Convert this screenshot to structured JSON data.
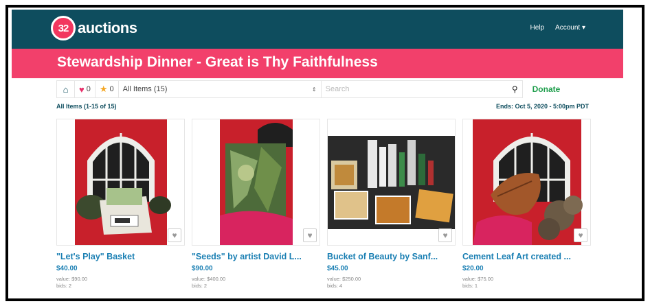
{
  "brand": {
    "logo_mark": "32",
    "logo_text": "auctions"
  },
  "topnav": {
    "help": "Help",
    "account": "Account",
    "account_caret": "▾"
  },
  "banner": {
    "title": "Stewardship Dinner - Great is Thy Faithfulness"
  },
  "toolbar": {
    "home_icon": "⌂",
    "favorites_icon": "♥",
    "favorites_count": "0",
    "starred_icon": "★",
    "starred_count": "0",
    "filter_value": "All Items (15)",
    "filter_caret": "⇕",
    "search_placeholder": "Search",
    "search_icon": "⚲",
    "donate_label": "Donate"
  },
  "list": {
    "range_label": "All Items (1-15 of 15)",
    "ends_label": "Ends: Oct 5, 2020 - 5:00pm PDT"
  },
  "items": [
    {
      "title": "\"Let's Play\" Basket",
      "price": "$40.00",
      "value": "value: $90.00",
      "bids": "bids: 2",
      "heart": "♥"
    },
    {
      "title": "\"Seeds\" by artist David L...",
      "price": "$90.00",
      "value": "value: $400.00",
      "bids": "bids: 2",
      "heart": "♥"
    },
    {
      "title": "Bucket of Beauty by Sanf...",
      "price": "$45.00",
      "value": "value: $250.00",
      "bids": "bids: 4",
      "heart": "♥"
    },
    {
      "title": "Cement Leaf Art created ...",
      "price": "$20.00",
      "value": "value: $75.00",
      "bids": "bids: 1",
      "heart": "♥"
    }
  ],
  "colors": {
    "header": "#0e4d5e",
    "banner": "#f2406b",
    "link": "#1a7fb3",
    "donate": "#1e9e4c"
  }
}
